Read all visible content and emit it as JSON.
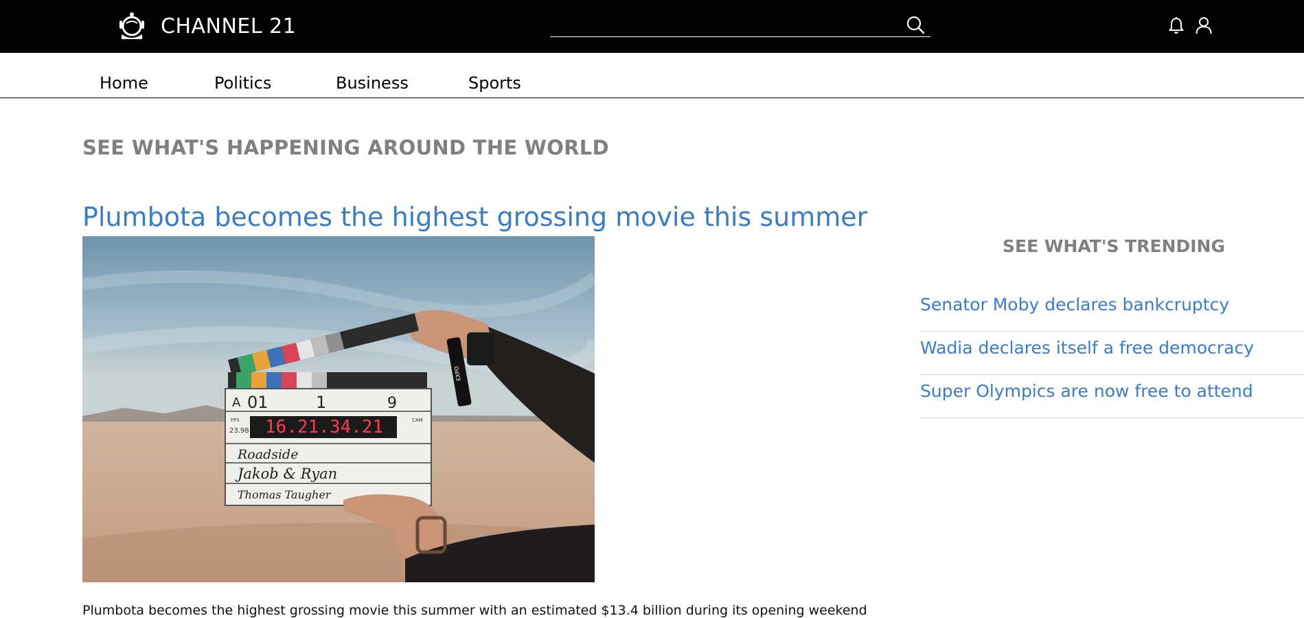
{
  "header": {
    "brand_name": "CHANNEL 21",
    "logo_icon": "astronaut-helmet-icon",
    "search": {
      "value": "",
      "placeholder": ""
    },
    "icons": [
      "search-icon",
      "bell-icon",
      "user-icon"
    ],
    "background_color": "#000000"
  },
  "nav": {
    "items": [
      {
        "label": "Home"
      },
      {
        "label": "Politics"
      },
      {
        "label": "Business"
      },
      {
        "label": "Sports"
      }
    ]
  },
  "main": {
    "section_heading": "SEE WHAT'S HAPPENING AROUND THE WORLD",
    "featured": {
      "headline": "Plumbota becomes the highest grossing movie this summer",
      "image": {
        "description_icon": "film-clapperboard-photo",
        "clapper_text": {
          "roll": "A",
          "scene": "01",
          "shot": "1",
          "take": "9",
          "fps_label": "FPS",
          "fps_value": "23.98",
          "cam_label": "CAM",
          "timecode": "16.21.34.21",
          "production": "Roadside",
          "director": "Jakob & Ryan",
          "camera_op": "Thomas Taugher",
          "marker": "EXPO"
        }
      },
      "summary": "Plumbota becomes the highest grossing movie this summer with an estimated $13.4 billion during its opening weekend"
    }
  },
  "sidebar": {
    "heading": "SEE WHAT'S TRENDING",
    "items": [
      {
        "label": "Senator Moby declares bankcruptcy"
      },
      {
        "label": "Wadia declares itself a free democracy"
      },
      {
        "label": "Super Olympics are now free to attend"
      }
    ]
  },
  "colors": {
    "link_blue": "#3a7cc7",
    "heading_gray": "#808080",
    "header_black": "#000000"
  }
}
